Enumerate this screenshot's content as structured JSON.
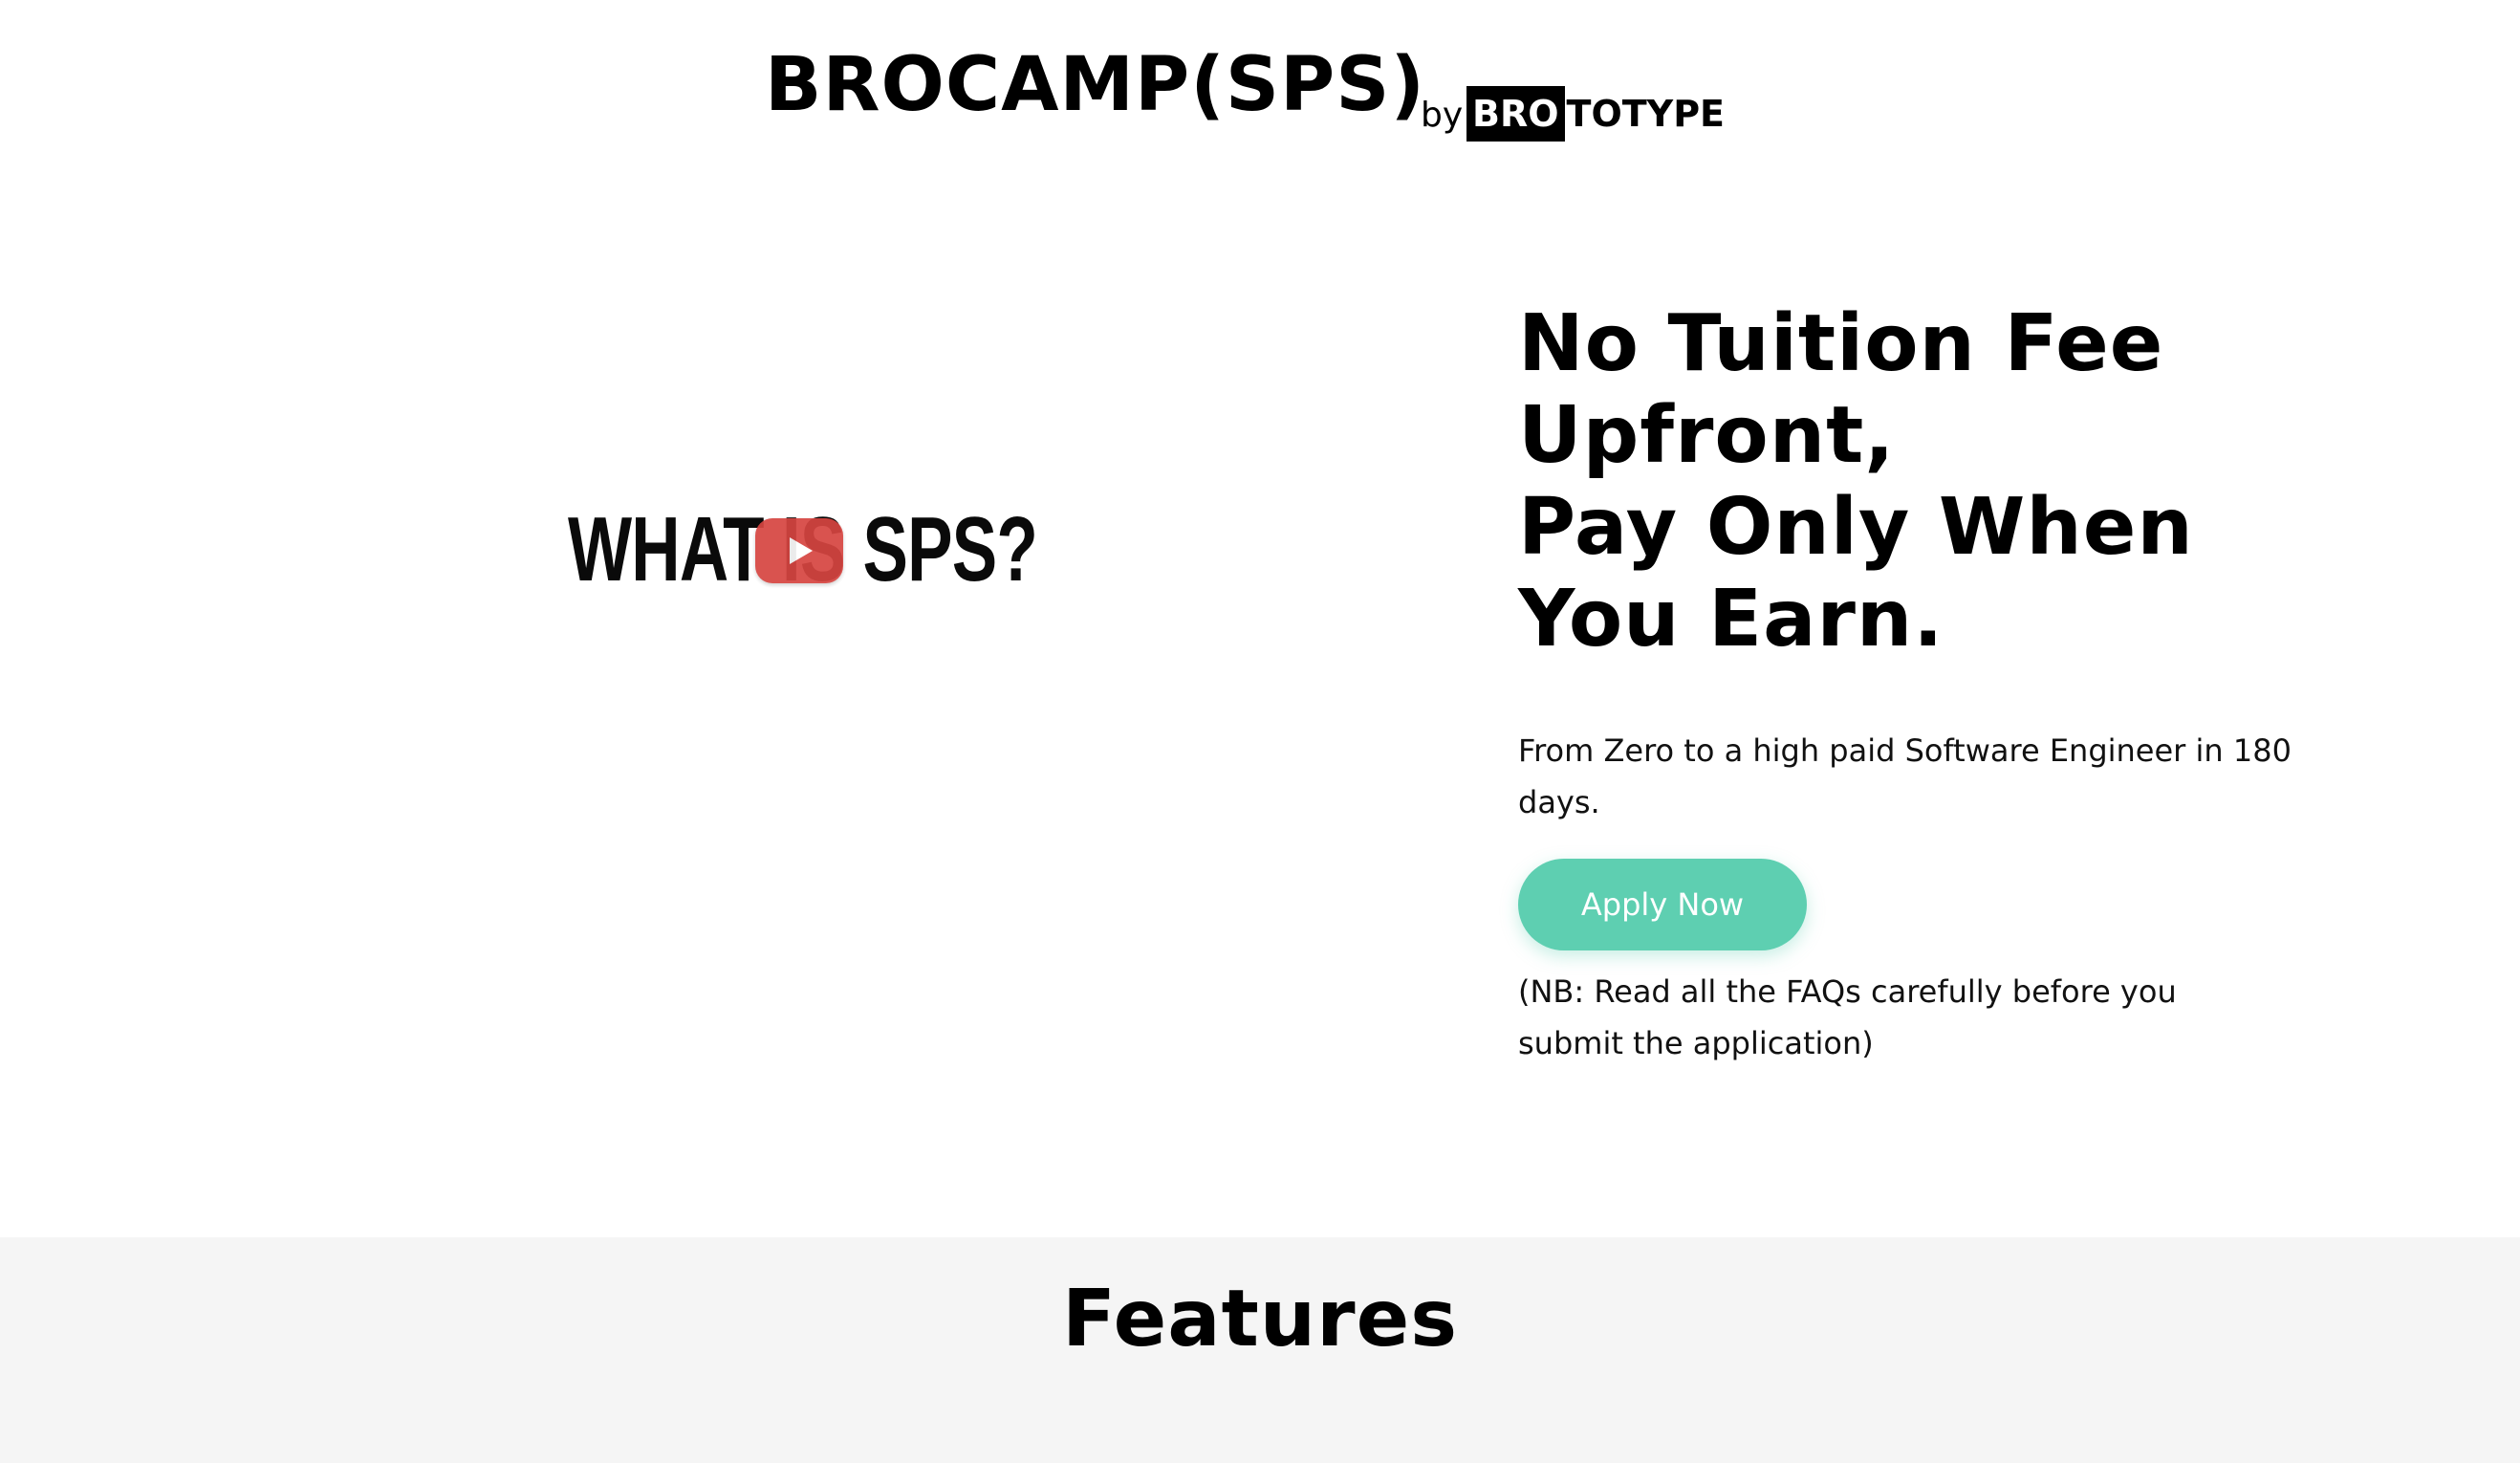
{
  "header": {
    "title": "BROCAMP(SPS)",
    "by": "by",
    "logo_highlight": "BRO",
    "logo_rest": "TOTYPE"
  },
  "video": {
    "title_text": "WHAT IS SPS?",
    "play_icon": "play-icon"
  },
  "hero": {
    "heading_lines": [
      "No Tuition Fee",
      "Upfront,",
      "Pay Only When",
      "You Earn."
    ],
    "subtitle": "From Zero to a high paid Software Engineer in 180 days.",
    "apply_label": "Apply Now",
    "note": "(NB: Read all the FAQs carefully before you submit the application)"
  },
  "features": {
    "title": "Features"
  },
  "colors": {
    "accent": "#5ecfb1",
    "features_bg": "#f5f5f5",
    "play_red": "#d64541",
    "text": "#000000"
  }
}
